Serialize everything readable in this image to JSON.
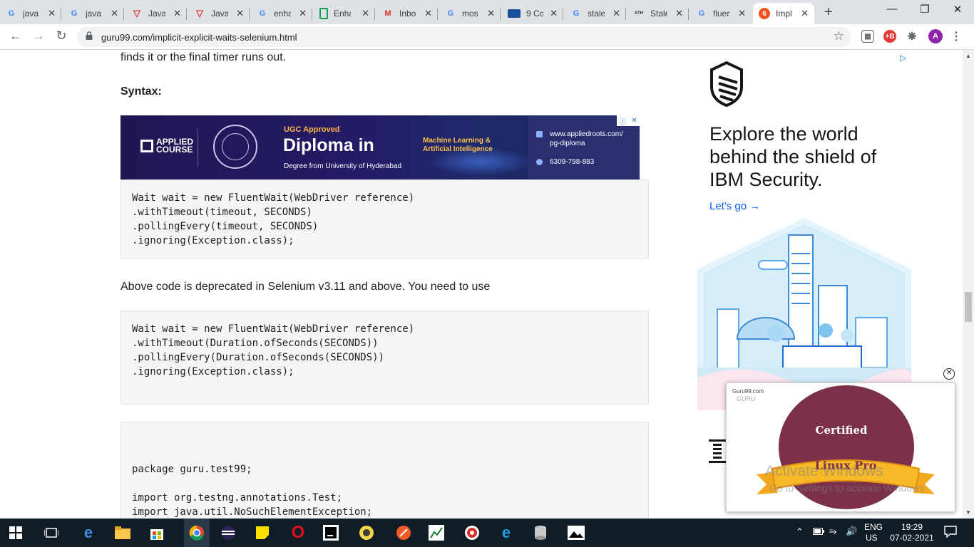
{
  "browser": {
    "tabs": [
      {
        "label": "java",
        "favicon": "google-icon",
        "color": "#4285f4"
      },
      {
        "label": "java",
        "favicon": "google-icon",
        "color": "#4285f4"
      },
      {
        "label": "Java",
        "favicon": "guru99-v-icon",
        "color": "#e53935"
      },
      {
        "label": "Java",
        "favicon": "guru99-v-icon",
        "color": "#e53935"
      },
      {
        "label": "enha",
        "favicon": "google-icon",
        "color": "#4285f4"
      },
      {
        "label": "Enha",
        "favicon": "doc-icon",
        "color": "#0f9d58"
      },
      {
        "label": "Inbo",
        "favicon": "gmail-icon",
        "color": "#d93025"
      },
      {
        "label": "mos",
        "favicon": "google-icon",
        "color": "#4285f4"
      },
      {
        "label": "9 Co",
        "favicon": "chart-icon",
        "color": "#1a4f9c"
      },
      {
        "label": "stale",
        "favicon": "google-icon",
        "color": "#4285f4"
      },
      {
        "label": "Stale",
        "favicon": "stackoverflow-icon",
        "color": "#333"
      },
      {
        "label": "fluen",
        "favicon": "google-icon",
        "color": "#4285f4"
      },
      {
        "label": "Impl",
        "favicon": "guru99-icon",
        "color": "#f4511e",
        "active": true
      }
    ],
    "url": "guru99.com/implicit-explicit-waits-selenium.html",
    "profile_initial": "A",
    "ext_badge": "+B"
  },
  "article": {
    "intro_tail": "finds it or the final timer runs out.",
    "syntax_heading": "Syntax:",
    "code1": [
      "Wait wait = new FluentWait(WebDriver reference)",
      ".withTimeout(timeout, SECONDS)",
      ".pollingEvery(timeout, SECONDS)",
      ".ignoring(Exception.class);"
    ],
    "deprecated_note": "Above code is deprecated in Selenium v3.11 and above. You need to use",
    "code2": [
      "Wait wait = new FluentWait(WebDriver reference)",
      ".withTimeout(Duration.ofSeconds(SECONDS))",
      ".pollingEvery(Duration.ofSeconds(SECONDS))",
      ".ignoring(Exception.class);"
    ],
    "code3": [
      "package guru.test99;",
      "",
      "import org.testng.annotations.Test;",
      "import java.util.NoSuchElementException;"
    ]
  },
  "ad_banner": {
    "brand_line1": "APPLIED",
    "brand_line2": "COURSE",
    "ugc": "UGC Approved",
    "title": "Diploma in",
    "subtitle": "Degree from University of Hyderabad",
    "topic_line1": "Machine Learning &",
    "topic_line2": "Artificial Intelligence",
    "site_line1": "www.appliedroots.com/",
    "site_line2": "pg-diploma",
    "phone": "6309-798-883"
  },
  "ibm_ad": {
    "headline": "Explore the world behind the shield of IBM Security.",
    "cta": "Let's go →"
  },
  "overlay": {
    "site": "Guru99.com",
    "guru": "GURU",
    "certified": "Certified",
    "badge": "Linux Pro"
  },
  "watermark": {
    "line1": "Activate Windows",
    "line2": "Go to Settings to activate Windows."
  },
  "taskbar": {
    "lang1": "ENG",
    "lang2": "US",
    "time": "19:29",
    "date": "07-02-2021"
  }
}
